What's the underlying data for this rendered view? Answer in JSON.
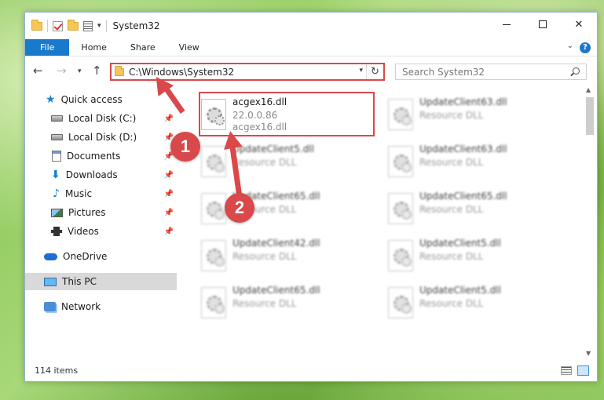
{
  "window": {
    "title": "System32",
    "controls": {
      "minimize": "",
      "maximize": "",
      "close": "✕"
    }
  },
  "ribbon": {
    "tabs": [
      "File",
      "Home",
      "Share",
      "View"
    ],
    "help": "?"
  },
  "address": {
    "path": "C:\\Windows\\System32",
    "search_placeholder": "Search System32"
  },
  "nav": {
    "quick_access": "Quick access",
    "items": [
      {
        "label": "Local Disk (C:)",
        "icon": "drive-icon"
      },
      {
        "label": "Local Disk (D:)",
        "icon": "drive-icon"
      },
      {
        "label": "Documents",
        "icon": "documents-icon"
      },
      {
        "label": "Downloads",
        "icon": "downloads-icon"
      },
      {
        "label": "Music",
        "icon": "music-icon"
      },
      {
        "label": "Pictures",
        "icon": "pictures-icon"
      },
      {
        "label": "Videos",
        "icon": "videos-icon"
      }
    ],
    "onedrive": "OneDrive",
    "this_pc": "This PC",
    "network": "Network"
  },
  "files": {
    "selected": {
      "name": "acgex16.dll",
      "version": "22.0.0.86",
      "description": "acgex16.dll"
    },
    "left_column": [
      {
        "name": "UpdateClient5.dll",
        "type": "Resource DLL"
      },
      {
        "name": "UpdateClient65.dll",
        "type": "Resource DLL"
      },
      {
        "name": "UpdateClient42.dll",
        "type": "Resource DLL"
      },
      {
        "name": "UpdateClient65.dll",
        "type": "Resource DLL"
      }
    ],
    "right_column": [
      {
        "name": "UpdateClient63.dll",
        "type": "Resource DLL"
      },
      {
        "name": "UpdateClient63.dll",
        "type": "Resource DLL"
      },
      {
        "name": "UpdateClient65.dll",
        "type": "Resource DLL"
      },
      {
        "name": "UpdateClient5.dll",
        "type": "Resource DLL"
      },
      {
        "name": "UpdateClient5.dll",
        "type": "Resource DLL"
      }
    ]
  },
  "status": {
    "item_count": "114 items"
  },
  "callouts": {
    "one": "1",
    "two": "2"
  },
  "colors": {
    "accent": "#1979ca",
    "highlight": "#d9484a"
  }
}
